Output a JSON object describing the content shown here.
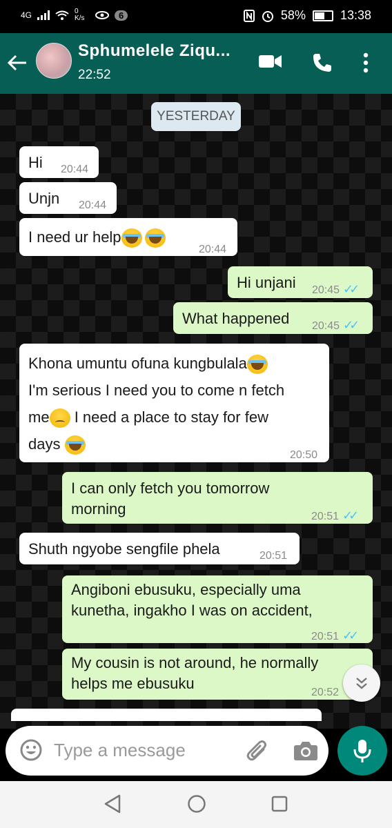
{
  "statusbar": {
    "network": "4G",
    "speed": "0 K/s",
    "notif_count": "6",
    "battery": "58%",
    "time": "13:38"
  },
  "header": {
    "contact_name": "Sphumelele Ziqu...",
    "last_seen": "22:52"
  },
  "chat": {
    "date_label": "YESTERDAY",
    "messages": [
      {
        "dir": "in",
        "text": "Hi",
        "time": "20:44"
      },
      {
        "dir": "in",
        "text": "Unjn",
        "time": "20:44"
      },
      {
        "dir": "in",
        "text": "I need ur help",
        "emoji": "crying-face x2",
        "time": "20:44"
      },
      {
        "dir": "out",
        "text": "Hi unjani",
        "time": "20:45",
        "status": "read"
      },
      {
        "dir": "out",
        "text": "What happened",
        "time": "20:45",
        "status": "read"
      },
      {
        "dir": "in",
        "lines": [
          "Khona umuntu ofuna kungbulala",
          "I'm serious I need you to come n fetch",
          "me",
          "I need a place to stay for few",
          "days"
        ],
        "time": "20:50"
      },
      {
        "dir": "out",
        "lines": [
          "I can only fetch you tomorrow",
          "morning"
        ],
        "time": "20:51",
        "status": "read"
      },
      {
        "dir": "in",
        "text": "Shuth ngyobe sengfile phela",
        "time": "20:51"
      },
      {
        "dir": "out",
        "lines": [
          "Angiboni ebusuku, especially uma",
          "kunetha, ingakho I was on accident,"
        ],
        "time": "20:51",
        "status": "read"
      },
      {
        "dir": "out",
        "lines": [
          "My cousin is not around, he normally",
          "helps me ebusuku"
        ],
        "time": "20:52",
        "status": "read"
      }
    ]
  },
  "input": {
    "placeholder": "Type a message"
  },
  "colors": {
    "header_bg": "#075e54",
    "outgoing_bubble": "#dcf8c6",
    "incoming_bubble": "#ffffff",
    "read_tick": "#4fc3f7",
    "mic_button": "#00897b"
  },
  "icons": [
    "back-arrow-icon",
    "video-call-icon",
    "voice-call-icon",
    "more-menu-icon",
    "emoji-icon",
    "attach-icon",
    "camera-icon",
    "mic-icon",
    "scroll-down-icon",
    "nav-back-icon",
    "nav-home-icon",
    "nav-recent-icon"
  ]
}
